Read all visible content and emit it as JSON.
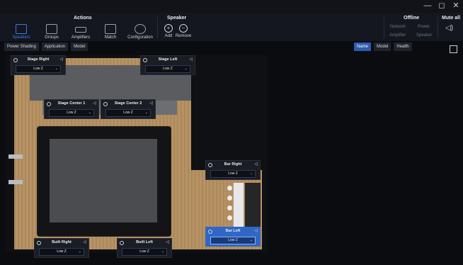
{
  "window": {
    "minimize": "—",
    "maximize": "◻",
    "close": "✕"
  },
  "ribbon": {
    "actions_title": "Actions",
    "actions": [
      {
        "label": "Speakers",
        "icon": "speakers-icon",
        "active": true
      },
      {
        "label": "Groups",
        "icon": "groups-icon"
      },
      {
        "label": "Amplifiers",
        "icon": "amplifiers-icon"
      },
      {
        "label": "Match",
        "icon": "match-icon"
      },
      {
        "label": "Configuration",
        "icon": "configuration-icon"
      }
    ],
    "speaker_title": "Speaker",
    "speaker_actions": [
      {
        "label": "Add",
        "icon": "plus-circle-icon",
        "glyph": "+"
      },
      {
        "label": "Remove",
        "icon": "minus-circle-icon",
        "glyph": "−"
      }
    ],
    "offline_title": "Offline",
    "offline_items": [
      "Network",
      "Power",
      "Amplifier",
      "Speaker"
    ],
    "mute_all_label": "Mute all",
    "mute_icon": "speaker-icon"
  },
  "left_tabs": [
    "Power Shading",
    "Application",
    "Model"
  ],
  "right_tabs": [
    {
      "label": "Name",
      "active": true
    },
    {
      "label": "Model",
      "active": false
    },
    {
      "label": "Health",
      "active": false
    }
  ],
  "speakers": [
    {
      "name": "Stage Right",
      "value": "Low Z"
    },
    {
      "name": "Stage Left",
      "value": "Low Z"
    },
    {
      "name": "Stage Center 1",
      "value": "Low Z"
    },
    {
      "name": "Stage Center 2",
      "value": "Low Z"
    },
    {
      "name": "Bar Right",
      "value": "Low Z"
    },
    {
      "name": "Bar Left",
      "value": "Low Z",
      "selected": true
    },
    {
      "name": "Built Right",
      "value": "Low Z"
    },
    {
      "name": "Built Left",
      "value": "Low Z"
    }
  ],
  "colors": {
    "accent": "#2f66c8",
    "background": "#0b0c10",
    "wood": "#b48f5f"
  }
}
